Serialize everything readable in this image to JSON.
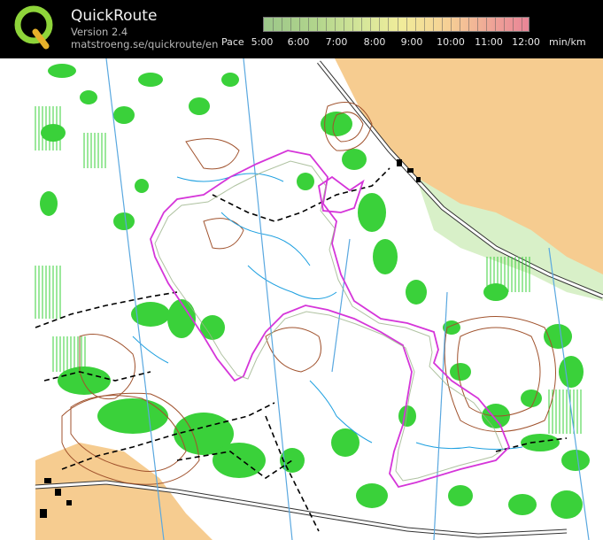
{
  "header": {
    "app_name": "QuickRoute",
    "version": "Version 2.4",
    "url": "matstroeng.se/quickroute/en",
    "logo_letter": "Q"
  },
  "pace_scale": {
    "label": "Pace",
    "ticks": [
      "5:00",
      "6:00",
      "7:00",
      "8:00",
      "9:00",
      "10:00",
      "11:00",
      "12:00"
    ],
    "unit": "min/km",
    "gradient_colors": [
      "#9cc78a",
      "#d7e79a",
      "#f1ec9a",
      "#f6cf95",
      "#e98597"
    ]
  },
  "map": {
    "route_color": "#d535d9",
    "vegetation_color": "#3ad13a",
    "contour_color": "#a0522d",
    "water_color": "#1ea0e0",
    "open_land_color": "#f5c98a"
  }
}
